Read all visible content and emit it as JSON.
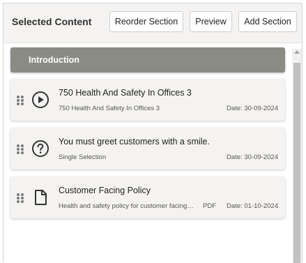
{
  "header": {
    "title": "Selected Content",
    "reorder_label": "Reorder Section",
    "preview_label": "Preview",
    "add_label": "Add Section"
  },
  "section": {
    "title": "Introduction"
  },
  "items": [
    {
      "icon": "play-circle-icon",
      "title": "750 Health And Safety In Offices 3",
      "subtitle": "750 Health And Safety In Offices 3",
      "kind": "",
      "date": "Date: 30-09-2024"
    },
    {
      "icon": "question-circle-icon",
      "title": "You must greet customers with a smile.",
      "subtitle": "Single Selection",
      "kind": "",
      "date": "Date: 30-09-2024"
    },
    {
      "icon": "document-icon",
      "title": "Customer Facing Policy",
      "subtitle": "Health and safety policy for customer facing staff",
      "kind": "PDF",
      "date": "Date: 01-10-2024"
    }
  ]
}
